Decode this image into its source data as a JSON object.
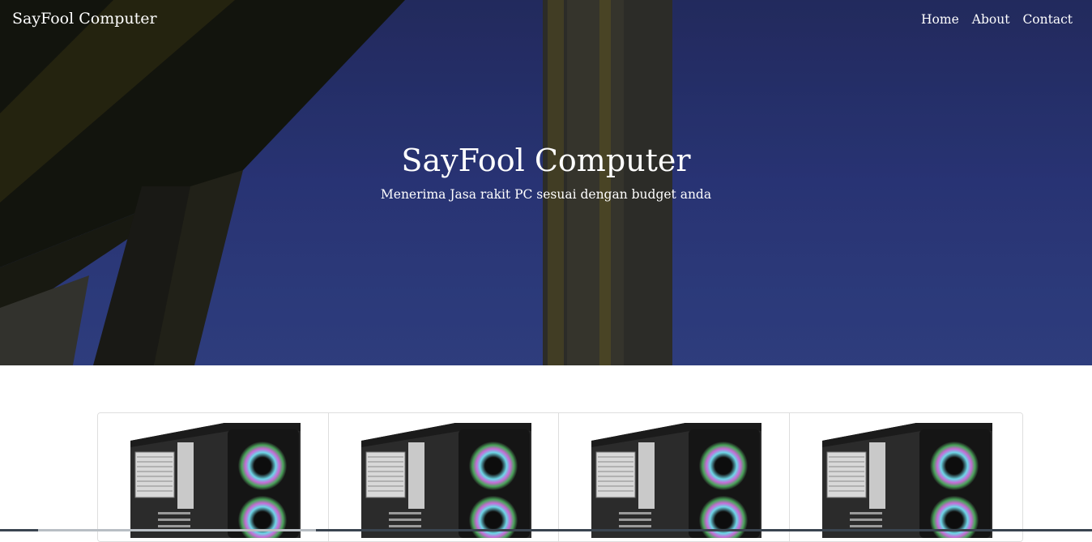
{
  "navbar": {
    "brand": "SayFool Computer",
    "links": [
      {
        "label": "Home"
      },
      {
        "label": "About"
      },
      {
        "label": "Contact"
      }
    ]
  },
  "hero": {
    "title": "SayFool Computer",
    "subtitle": "Menerima Jasa rakit PC sesuai dengan budget anda"
  },
  "products": {
    "items": [
      {
        "image": "pc-case-image"
      },
      {
        "image": "pc-case-image"
      },
      {
        "image": "pc-case-image"
      },
      {
        "image": "pc-case-image"
      }
    ]
  },
  "colors": {
    "hero_sky": "#2d3a82",
    "nav_text": "#ffffff",
    "card_border": "#dedede"
  }
}
